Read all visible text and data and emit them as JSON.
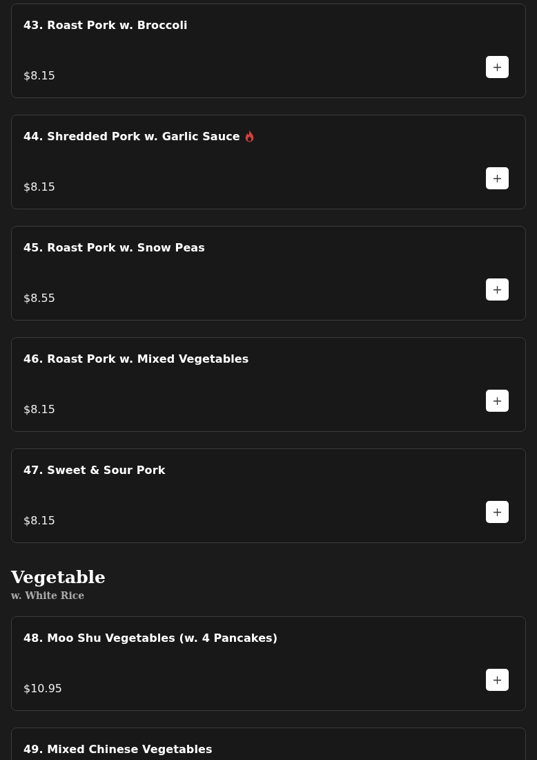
{
  "sections": [
    {
      "items": [
        {
          "name": "43. Roast Pork w. Broccoli",
          "spicy": false,
          "price": "$8.15"
        },
        {
          "name": "44. Shredded Pork w. Garlic Sauce",
          "spicy": true,
          "price": "$8.15"
        },
        {
          "name": "45. Roast Pork w. Snow Peas",
          "spicy": false,
          "price": "$8.55"
        },
        {
          "name": "46. Roast Pork w. Mixed Vegetables",
          "spicy": false,
          "price": "$8.15"
        },
        {
          "name": "47. Sweet & Sour Pork",
          "spicy": false,
          "price": "$8.15"
        }
      ]
    },
    {
      "title": "Vegetable",
      "subtitle": "w. White Rice",
      "items": [
        {
          "name": "48. Moo Shu Vegetables (w. 4 Pancakes)",
          "spicy": false,
          "price": "$10.95"
        },
        {
          "name": "49. Mixed Chinese Vegetables",
          "spicy": false
        }
      ]
    }
  ]
}
